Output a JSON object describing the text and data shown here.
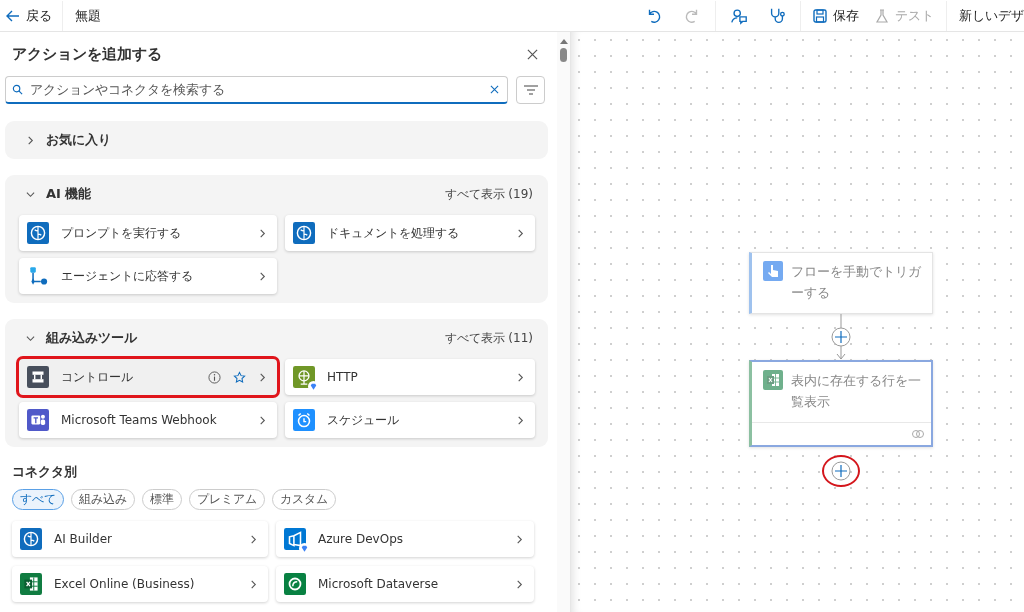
{
  "toolbar": {
    "back": "戻る",
    "title": "無題",
    "undo_disabled": false,
    "redo_disabled": true,
    "save": "保存",
    "test": {
      "label": "テスト",
      "disabled": true
    },
    "designer": "新しいデザ"
  },
  "panel": {
    "title": "アクションを追加する",
    "search": {
      "placeholder": "アクションやコネクタを検索する"
    }
  },
  "sections": [
    {
      "title": "お気に入り",
      "expanded": false
    },
    {
      "title": "AI 機能",
      "expanded": true,
      "see_all": "すべて表示 (19)",
      "items": [
        {
          "label": "プロンプトを実行する",
          "kind": "ai",
          "premium": false,
          "highlighted": false
        },
        {
          "label": "ドキュメントを処理する",
          "kind": "ai",
          "premium": false,
          "highlighted": false
        },
        {
          "label": "エージェントに応答する",
          "kind": "agent",
          "premium": false,
          "highlighted": false
        }
      ]
    },
    {
      "title": "組み込みツール",
      "expanded": true,
      "see_all": "すべて表示 (11)",
      "items": [
        {
          "label": "コントロール",
          "kind": "control",
          "premium": false,
          "highlighted": true
        },
        {
          "label": "HTTP",
          "kind": "http",
          "premium": true,
          "highlighted": false
        },
        {
          "label": "Microsoft Teams Webhook",
          "kind": "teams",
          "premium": false,
          "highlighted": false
        },
        {
          "label": "スケジュール",
          "kind": "schedule",
          "premium": false,
          "highlighted": false
        }
      ]
    }
  ],
  "connectors": {
    "title": "コネクタ別",
    "filters": [
      {
        "label": "すべて",
        "selected": true
      },
      {
        "label": "組み込み",
        "selected": false
      },
      {
        "label": "標準",
        "selected": false
      },
      {
        "label": "プレミアム",
        "selected": false
      },
      {
        "label": "カスタム",
        "selected": false
      }
    ],
    "items": [
      {
        "label": "AI Builder",
        "kind": "ai",
        "premium": false
      },
      {
        "label": "Azure DevOps",
        "kind": "devops",
        "premium": true
      },
      {
        "label": "Excel Online (Business)",
        "kind": "excel",
        "premium": false
      },
      {
        "label": "Microsoft Dataverse",
        "kind": "dataverse",
        "premium": false
      }
    ]
  },
  "flow": {
    "nodes": [
      {
        "label": "フローを手動でトリガーする",
        "kind": "trigger",
        "selected": false
      },
      {
        "label": "表内に存在する行を一覧表示",
        "kind": "excel",
        "selected": true
      }
    ],
    "add_button": {
      "highlighted": true
    }
  }
}
